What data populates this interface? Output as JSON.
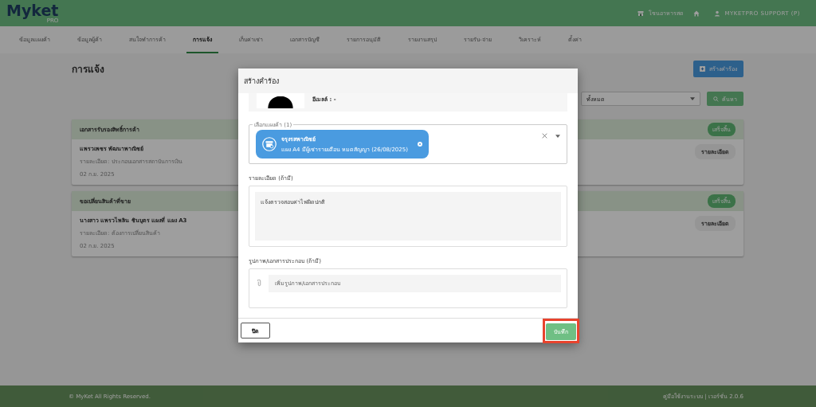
{
  "header": {
    "logo": "Myket",
    "logo_sub": "PRO",
    "zone": "โซนอาหารสด",
    "user": "MYKETPRO SUPPORT (P)"
  },
  "tabs": [
    {
      "label": "ข้อมูลแผงค้า",
      "selected": false
    },
    {
      "label": "ข้อมูลผู้ค้า",
      "selected": false
    },
    {
      "label": "สนใจทำการค้า",
      "selected": false
    },
    {
      "label": "การแจ้ง",
      "selected": true
    },
    {
      "label": "เก็บค่าเช่า",
      "selected": false
    },
    {
      "label": "เอกสารบัญชี",
      "selected": false
    },
    {
      "label": "รายการอนุมัติ",
      "selected": false
    },
    {
      "label": "รายงานสรุป",
      "selected": false
    },
    {
      "label": "รายรับ-จ่าย",
      "selected": false
    },
    {
      "label": "วิเคราะห์",
      "selected": false
    },
    {
      "label": "ตั้งค่า",
      "selected": false
    }
  ],
  "page": {
    "title": "การแจ้ง",
    "create_button": "สร้างคำร้อง",
    "filter_value": "ทั้งหมด",
    "search_button": "ค้นหา"
  },
  "cards": [
    {
      "title": "เอกสารรับรองสิทธิ์การค้า",
      "status": "เสร็จสิ้น",
      "name": "แพรวเพชร พัฒนาพาณิชย์",
      "detail": "รายละเอียด: ประกอบเอกสารสถาบันการเงิน",
      "date": "02 ก.ย. 2025",
      "button": "รายละเอียด"
    },
    {
      "title": "ขอเปลี่ยนสินค้าที่ขาย",
      "status": "เสร็จสิ้น",
      "name": "นางสาว แพรวไพลิน ชินบุตร แผงที่ แผง A3",
      "detail": "รายละเอียด: ต้องการเปลี่ยนสินค้า",
      "date": "02 ก.ย. 2025",
      "button": "รายละเอียด"
    }
  ],
  "modal": {
    "title": "สร้างคำร้อง",
    "email": "อีเมลล์ : -",
    "stall_label": "เลือกแผงค้า (1)",
    "chip_title": "จรุงรสพาณิชย์",
    "chip_subtitle": "แผง A4 มีผู้เช่ารายเดือน หมดสัญญา (26/08/2025)",
    "detail_label": "รายละเอียด (ถ้ามี)",
    "detail_value": "แจ้งตรวจสอบค่าไฟผิดปกติ",
    "attach_label": "รูปภาพ/เอกสารประกอบ (ถ้ามี)",
    "attach_placeholder": "เพิ่มรูปภาพ/เอกสารประกอบ",
    "close_button": "ปิด",
    "save_button": "บันทึก",
    "save_highlighted": true
  },
  "footer": {
    "copyright": "© MyKet All Rights Reserved.",
    "right": "คู่มือใช้งานระบบ | เวอร์ชั่น 2.0.6"
  }
}
